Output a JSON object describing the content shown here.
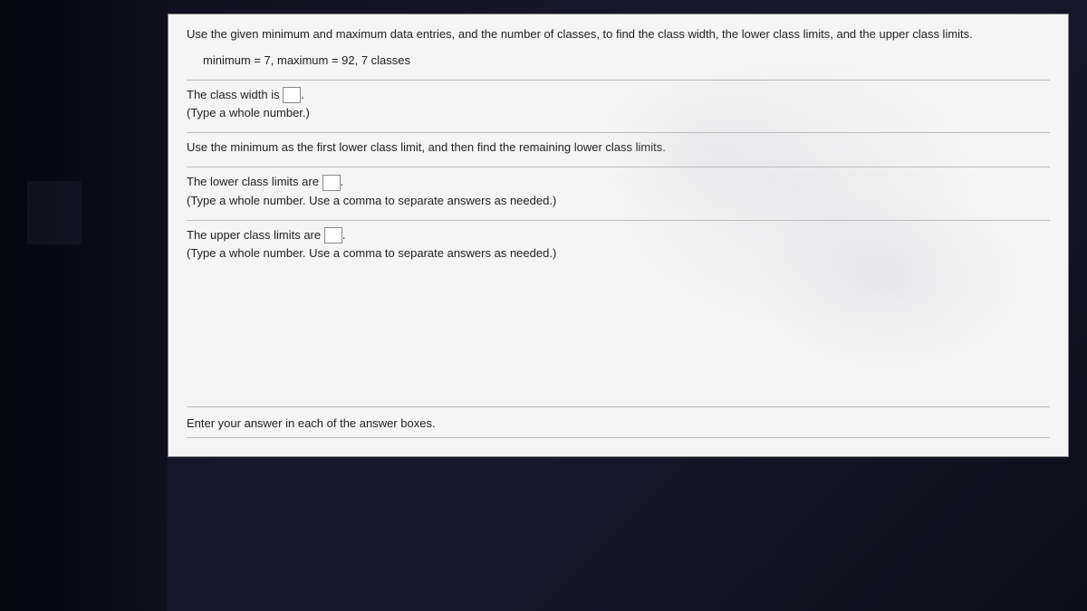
{
  "question": {
    "prompt": "Use the given minimum and maximum data entries, and the number of classes, to find the class width, the lower class limits, and the upper class limits.",
    "data": "minimum = 7,  maximum = 92, 7 classes"
  },
  "parts": {
    "class_width": {
      "label_before": "The class width is ",
      "label_after": ".",
      "hint": "(Type a whole number.)"
    },
    "lower_limits_instruction": "Use the minimum as the first lower class limit, and then find the remaining lower class limits.",
    "lower_limits": {
      "label_before": "The lower class limits are ",
      "label_after": ".",
      "hint": "(Type a whole number. Use a comma to separate answers as needed.)"
    },
    "upper_limits": {
      "label_before": "The upper class limits are ",
      "label_after": ".",
      "hint": "(Type a whole number. Use a comma to separate answers as needed.)"
    }
  },
  "footer": "Enter your answer in each of the answer boxes."
}
